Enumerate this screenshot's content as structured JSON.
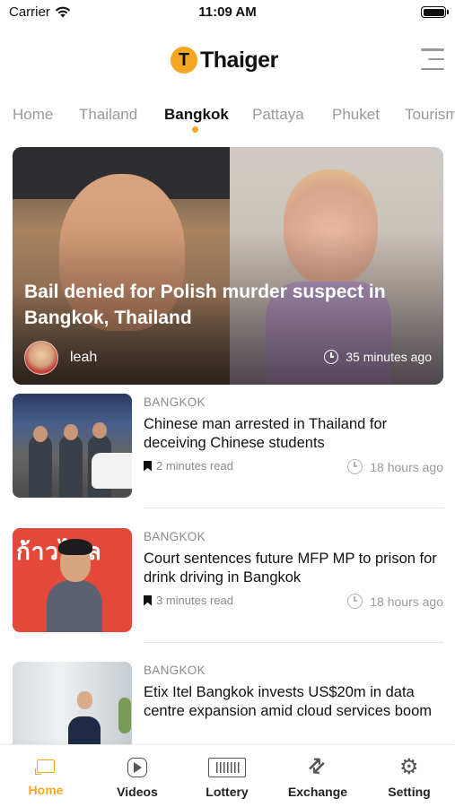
{
  "status_bar": {
    "carrier": "Carrier",
    "time": "11:09 AM"
  },
  "header": {
    "logo_mark": "T",
    "logo_text": "Thaiger",
    "menu_icon": "hamburger-menu-icon"
  },
  "tabs": [
    {
      "label": "Home",
      "active": false
    },
    {
      "label": "Thailand",
      "active": false
    },
    {
      "label": "Bangkok",
      "active": true
    },
    {
      "label": "Pattaya",
      "active": false
    },
    {
      "label": "Phuket",
      "active": false
    },
    {
      "label": "Tourism",
      "active": false
    }
  ],
  "accent_color": "#f5a623",
  "featured": {
    "title": "Bail denied for Polish murder suspect in Bangkok, Thailand",
    "author": "leah",
    "time_ago": "35 minutes ago"
  },
  "articles": [
    {
      "category": "BANGKOK",
      "title": "Chinese man arrested in Thailand for deceiving Chinese students",
      "read_time": "2 minutes read",
      "time_ago": "18 hours ago"
    },
    {
      "category": "BANGKOK",
      "title": "Court sentences future MFP MP to prison for drink driving in Bangkok",
      "read_time": "3 minutes read",
      "time_ago": "18 hours ago",
      "thumb_text": "ก้าวไกล"
    },
    {
      "category": "BANGKOK",
      "title": "Etix Itel Bangkok invests US$20m in data centre expansion amid cloud services boom"
    }
  ],
  "bottom_nav": [
    {
      "label": "Home",
      "icon": "home-icon",
      "active": true
    },
    {
      "label": "Videos",
      "icon": "play-icon",
      "active": false
    },
    {
      "label": "Lottery",
      "icon": "lottery-ticket-icon",
      "active": false
    },
    {
      "label": "Exchange",
      "icon": "exchange-icon",
      "active": false
    },
    {
      "label": "Setting",
      "icon": "gear-icon",
      "active": false
    }
  ]
}
